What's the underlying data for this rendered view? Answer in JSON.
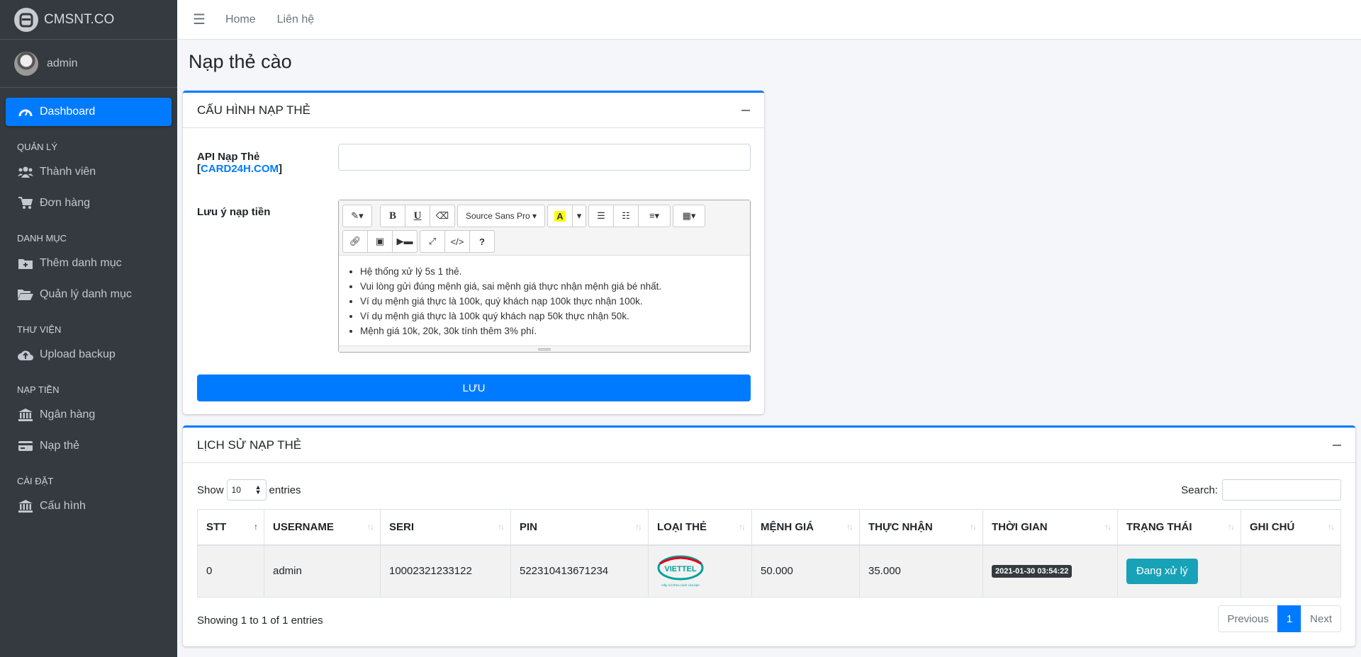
{
  "brand": {
    "name": "CMSNT.CO"
  },
  "user": {
    "name": "admin"
  },
  "sidebar": {
    "dashboard": "Dashboard",
    "sections": [
      {
        "title": "QUẢN LÝ",
        "items": [
          {
            "label": "Thành viên",
            "icon": "users-icon"
          },
          {
            "label": "Đơn hàng",
            "icon": "cart-icon"
          }
        ]
      },
      {
        "title": "DANH MỤC",
        "items": [
          {
            "label": "Thêm danh mục",
            "icon": "folder-plus-icon"
          },
          {
            "label": "Quản lý danh mục",
            "icon": "folder-open-icon"
          }
        ]
      },
      {
        "title": "THƯ VIỆN",
        "items": [
          {
            "label": "Upload backup",
            "icon": "cloud-upload-icon"
          }
        ]
      },
      {
        "title": "NẠP TIỀN",
        "items": [
          {
            "label": "Ngân hàng",
            "icon": "bank-icon"
          },
          {
            "label": "Nạp thẻ",
            "icon": "credit-card-icon"
          }
        ]
      },
      {
        "title": "CÀI ĐẶT",
        "items": [
          {
            "label": "Cấu hình",
            "icon": "bank-icon"
          }
        ]
      }
    ]
  },
  "topbar": {
    "home": "Home",
    "contact": "Liên hệ"
  },
  "page": {
    "title": "Nạp thẻ cào"
  },
  "config_card": {
    "title": "CẤU HÌNH NẠP THẺ",
    "api_label": "API Nạp Thẻ",
    "api_link": "CARD24H.COM",
    "api_value": "",
    "note_label": "Lưu ý nạp tiền",
    "font_name": "Source Sans Pro",
    "notes": [
      "Hệ thống xử lý 5s 1 thẻ.",
      "Vui lòng gửi đúng mệnh giá, sai mệnh giá thực nhận mệnh giá bé nhất.",
      "Ví dụ mệnh giá thực là 100k, quý khách nạp 100k thực nhận 100k.",
      "Ví dụ mệnh giá thực là 100k quý khách nạp 50k thực nhận 50k.",
      "Mệnh giá 10k, 20k, 30k tính thêm 3% phí."
    ],
    "save_label": "LƯU"
  },
  "history_card": {
    "title": "LỊCH SỬ NẠP THẺ",
    "show_label": "Show",
    "entries_label": "entries",
    "page_size": "10",
    "search_label": "Search:",
    "columns": [
      "STT",
      "USERNAME",
      "SERI",
      "PIN",
      "LOẠI THẺ",
      "MỆNH GIÁ",
      "THỰC NHẬN",
      "THỜI GIAN",
      "TRẠNG THÁI",
      "GHI CHÚ"
    ],
    "rows": [
      {
        "stt": "0",
        "username": "admin",
        "seri": "10002321233122",
        "pin": "522310413671234",
        "card_type": "VIETTEL",
        "card_slogan": "Hãy nói theo cách của bạn",
        "value": "50.000",
        "received": "35.000",
        "time": "2021-01-30 03:54:22",
        "status": "Đang xử lý",
        "note": ""
      }
    ],
    "info": "Showing 1 to 1 of 1 entries",
    "pager": {
      "prev": "Previous",
      "page": "1",
      "next": "Next"
    }
  },
  "colors": {
    "primary": "#007bff",
    "sidebar": "#343a40",
    "info": "#17a2b8",
    "viettel": "#00a19a"
  }
}
